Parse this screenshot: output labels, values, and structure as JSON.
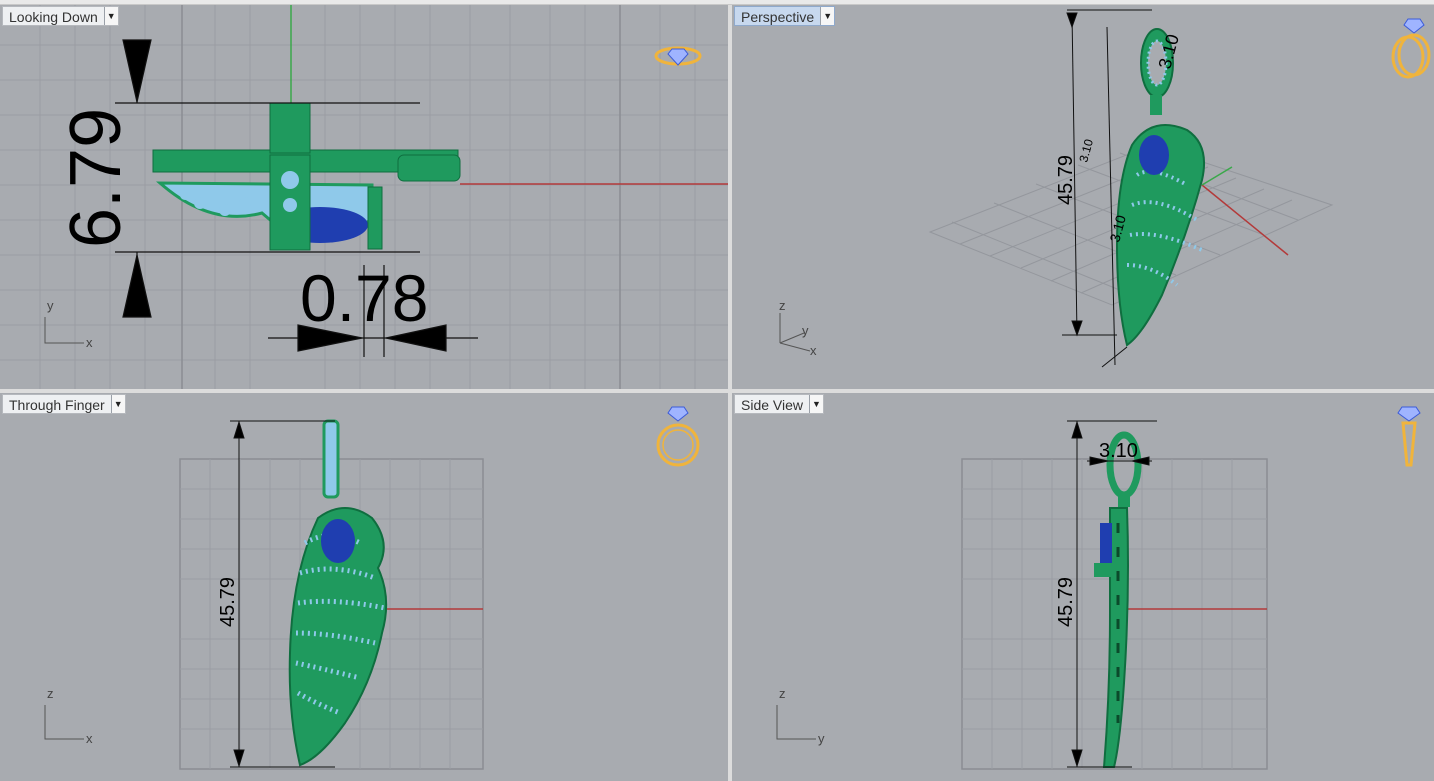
{
  "viewports": {
    "top_left": {
      "title": "Looking Down",
      "icon": "ring-top-icon",
      "dim_height": "6.79",
      "dim_width": "0.78",
      "axis_v": "y",
      "axis_h": "x",
      "active": false
    },
    "top_right": {
      "title": "Perspective",
      "icon": "ring-perspective-icon",
      "dim_height": "45.79",
      "dim_top": "3.10",
      "dim_side": "3.10",
      "dim_small": "3.10",
      "axis_z": "z",
      "axis_y": "y",
      "axis_x": "x",
      "active": true
    },
    "bottom_left": {
      "title": "Through Finger",
      "icon": "ring-front-icon",
      "dim_height": "45.79",
      "axis_v": "z",
      "axis_h": "x",
      "active": false
    },
    "bottom_right": {
      "title": "Side View",
      "icon": "ring-side-icon",
      "dim_height": "45.79",
      "dim_top": "3.10",
      "axis_v": "z",
      "axis_h": "y",
      "active": false
    }
  },
  "colors": {
    "viewport_bg": "#a8abb0",
    "grid_minor": "#9a9da3",
    "grid_major": "#8a8d93",
    "metal": "#1f9a5e",
    "metal_dark": "#0f6e3f",
    "stones": "#8fc9ea",
    "sapphire": "#1f3eb0",
    "axis_red": "#b33a3a",
    "axis_green": "#3aa84a",
    "icon_gold": "#f0b43c"
  }
}
